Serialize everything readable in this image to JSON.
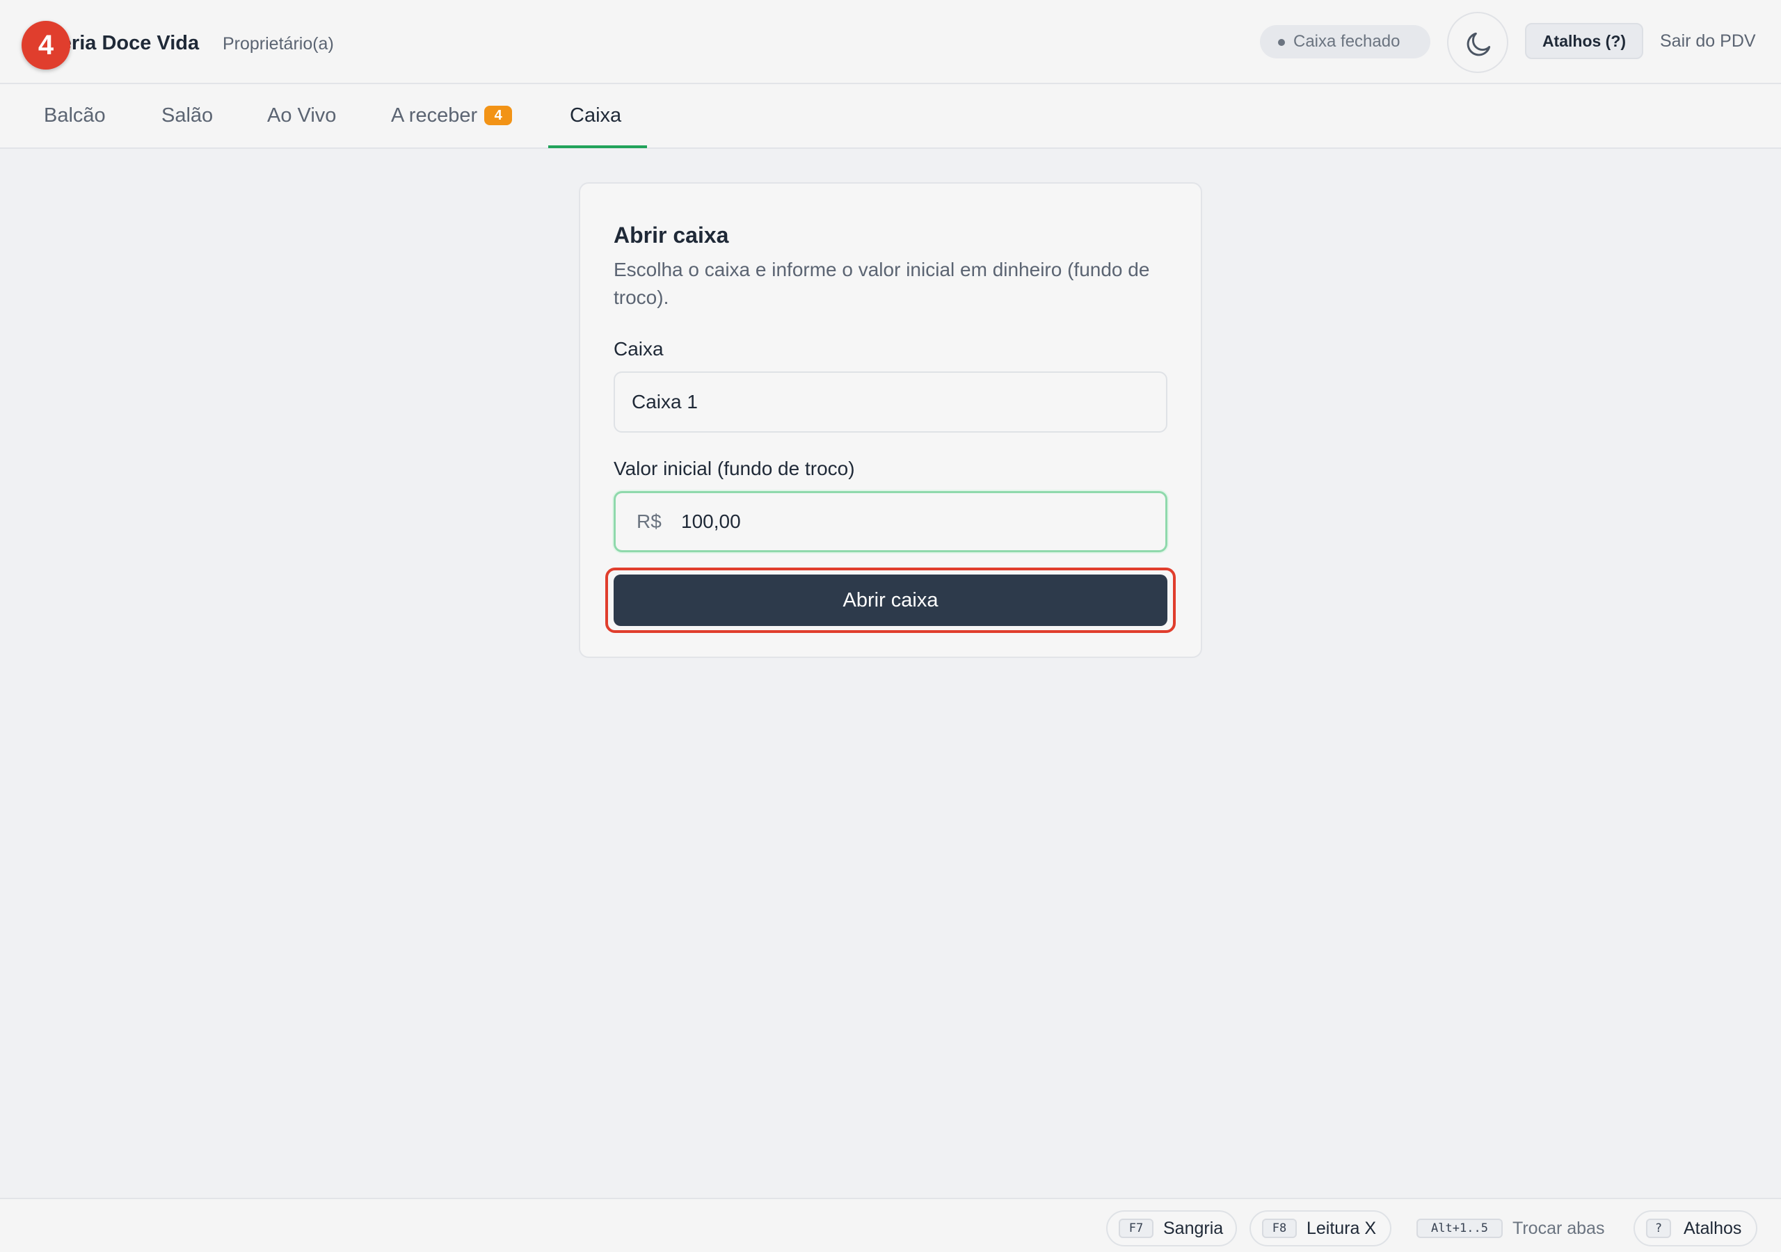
{
  "header": {
    "step_number": "4",
    "brand_title": "Doceria Doce Vida",
    "role": "Proprietário(a)",
    "status": "Caixa fechado",
    "shortcuts_button": "Atalhos (?)",
    "exit_link": "Sair do PDV",
    "theme_icon": "moon-icon"
  },
  "tabs": [
    {
      "label": "Balcão"
    },
    {
      "label": "Salão"
    },
    {
      "label": "Ao Vivo"
    },
    {
      "label": "A receber",
      "count": "4"
    },
    {
      "label": "Caixa",
      "active": true
    }
  ],
  "card": {
    "title": "Abrir caixa",
    "description": "Escolha o caixa e informe o valor inicial em dinheiro (fundo de troco).",
    "register_label": "Caixa",
    "register_value": "Caixa 1",
    "amount_label": "Valor inicial (fundo de troco)",
    "currency_prefix": "R$",
    "amount_value": "100,00",
    "submit_label": "Abrir caixa"
  },
  "footer": {
    "shortcuts": [
      {
        "key": "F7",
        "label": "Sangria"
      },
      {
        "key": "F8",
        "label": "Leitura X"
      },
      {
        "key": "Alt+1..5",
        "label": "Trocar abas"
      },
      {
        "key": "?",
        "label": "Atalhos"
      }
    ]
  },
  "colors": {
    "accent_green": "#22a35a",
    "primary_button": "#2d3a4b",
    "highlight_red": "#e03e2d",
    "badge_orange": "#f29316"
  }
}
